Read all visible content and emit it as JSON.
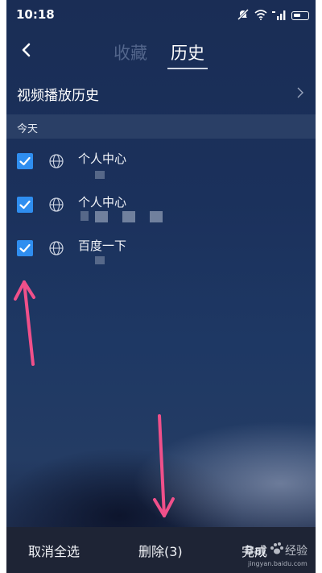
{
  "status_bar": {
    "time": "10:18"
  },
  "header": {
    "back_icon": "chevron-left-icon",
    "tabs": [
      {
        "label": "收藏",
        "active": false
      },
      {
        "label": "历史",
        "active": true
      }
    ]
  },
  "video_history": {
    "label": "视频播放历史",
    "icon": "chevron-right-icon"
  },
  "section": {
    "label": "今天"
  },
  "items": [
    {
      "title": "个人中心",
      "checked": true
    },
    {
      "title": "个人中心",
      "checked": true
    },
    {
      "title": "百度一下",
      "checked": true
    }
  ],
  "bottom_bar": {
    "deselect_all": "取消全选",
    "delete": "删除(3)",
    "done": "完成"
  },
  "watermark": {
    "brand": "Bai",
    "suffix": "经验",
    "url": "jingyan.baidu.com"
  },
  "colors": {
    "accent": "#2f8ef0",
    "annotation_arrow": "#f0508a",
    "inactive_tab": "#52658b"
  }
}
